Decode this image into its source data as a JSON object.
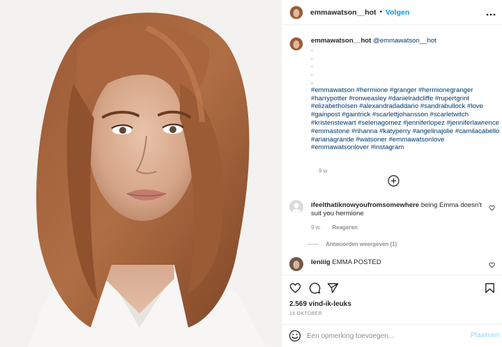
{
  "header": {
    "username": "emmawatson__hot",
    "separator": "•",
    "follow_label": "Volgen",
    "more_icon": "more-horizontal-icon"
  },
  "caption": {
    "username": "emmawatson__hot",
    "mention": "@emmawatson__hot",
    "dots": [
      ".",
      ".",
      ".",
      ".",
      "."
    ],
    "hashtags": "#emmawatson #hermione #granger #hermionegranger #harrypotter #ronweasley #danielradcliffe #rupertgrint #elizabetholsen #alexandradaddario #sandrabullock #love #gainpost #gaintrick #scarlettjohansson #scarletwitch #kristenstewart #selenagomez #jenniferlopez #jenniferlawrence #emmastone #rihanna #katyperry #angelinajolie #camilacabello #arianagrande #watsoner #emmawatsonlove #emmawatsonlover #instagram",
    "age": "9 w."
  },
  "comments": [
    {
      "username": "ifeelthatiknowyoufromsomewhere",
      "text": "being Emma doesn't suit you hermione",
      "age": "9 w.",
      "reply_label": "Reageren",
      "view_replies": "Antwoorden weergeven (1)"
    },
    {
      "username": "leniiig",
      "text": "EMMA POSTED"
    }
  ],
  "actions": {
    "icons": [
      "heart-icon",
      "comment-icon",
      "share-icon",
      "bookmark-icon"
    ],
    "likes": "2.569 vind-ik-leuks",
    "date": "16 OKTOBER"
  },
  "comment_box": {
    "placeholder": "Een opmerking toevoegen...",
    "post_label": "Plaatsen"
  },
  "colors": {
    "accent": "#0095f6",
    "link": "#00376b",
    "muted": "#8e8e8e",
    "border": "#efefef"
  }
}
